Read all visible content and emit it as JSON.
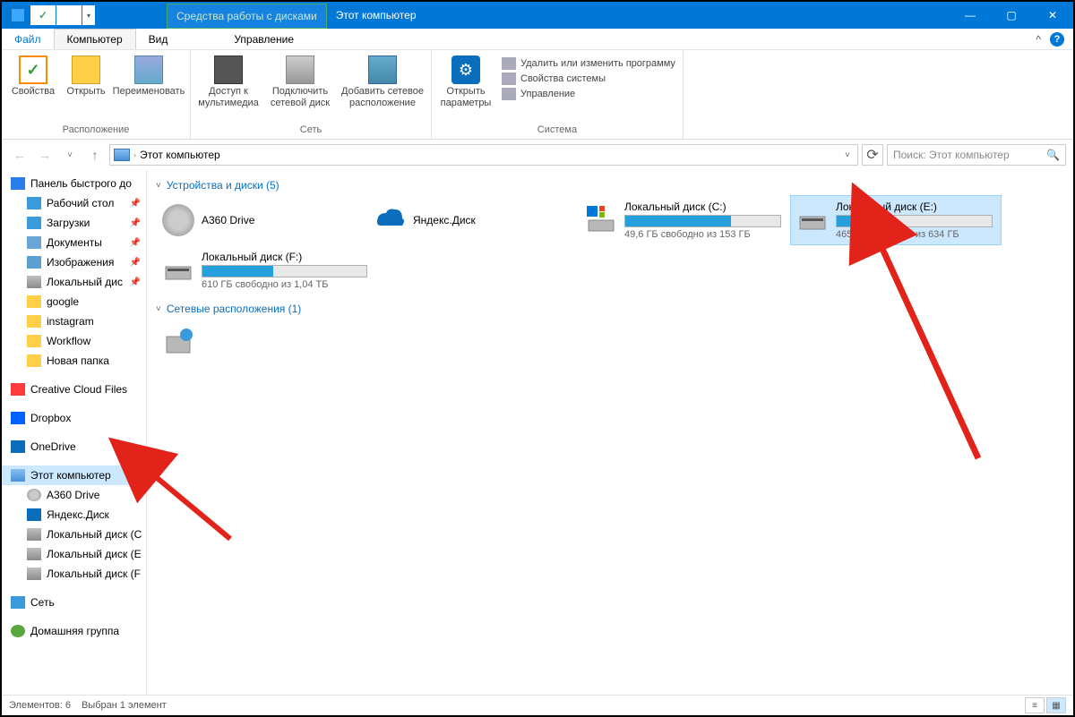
{
  "window": {
    "ctx_tab": "Средства работы с дисками",
    "title": "Этот компьютер",
    "minimize": "—",
    "maximize": "▢",
    "close": "✕"
  },
  "tabs": {
    "file": "Файл",
    "computer": "Компьютер",
    "view": "Вид",
    "manage": "Управление",
    "collapse": "^"
  },
  "ribbon": {
    "properties": "Свойства",
    "open": "Открыть",
    "rename": "Переименовать",
    "group_location": "Расположение",
    "media_access": "Доступ к\nмультимедиа",
    "map_drive": "Подключить\nсетевой диск",
    "add_net": "Добавить сетевое\nрасположение",
    "group_network": "Сеть",
    "open_settings": "Открыть\nпараметры",
    "uninstall": "Удалить или изменить программу",
    "sys_props": "Свойства системы",
    "manage": "Управление",
    "group_system": "Система"
  },
  "addr": {
    "path": "Этот компьютер",
    "refresh": "⟳"
  },
  "search": {
    "placeholder": "Поиск: Этот компьютер"
  },
  "sidebar": {
    "quick": "Панель быстрого до",
    "items1": [
      {
        "lb": "Рабочий стол",
        "ic": "ic-desk",
        "pin": true
      },
      {
        "lb": "Загрузки",
        "ic": "ic-dl",
        "pin": true
      },
      {
        "lb": "Документы",
        "ic": "ic-doc",
        "pin": true
      },
      {
        "lb": "Изображения",
        "ic": "ic-img",
        "pin": true
      },
      {
        "lb": "Локальный дис",
        "ic": "ic-drive",
        "pin": true
      },
      {
        "lb": "google",
        "ic": "ic-folder",
        "pin": false
      },
      {
        "lb": "instagram",
        "ic": "ic-folder",
        "pin": false
      },
      {
        "lb": "Workflow",
        "ic": "ic-folder",
        "pin": false
      },
      {
        "lb": "Новая папка",
        "ic": "ic-folder",
        "pin": false
      }
    ],
    "cc": "Creative Cloud Files",
    "dropbox": "Dropbox",
    "onedrive": "OneDrive",
    "thispc": "Этот компьютер",
    "items2": [
      {
        "lb": "A360 Drive",
        "ic": "ic-a360"
      },
      {
        "lb": "Яндекс.Диск",
        "ic": "ic-yd"
      },
      {
        "lb": "Локальный диск (С",
        "ic": "ic-drive"
      },
      {
        "lb": "Локальный диск (E",
        "ic": "ic-drive"
      },
      {
        "lb": "Локальный диск (F",
        "ic": "ic-drive"
      }
    ],
    "network": "Сеть",
    "homegroup": "Домашняя группа"
  },
  "content": {
    "sec_devices": "Устройства и диски (5)",
    "sec_network": "Сетевые расположения (1)",
    "a360": "A360 Drive",
    "yadisk": "Яндекс.Диск",
    "c": {
      "name": "Локальный диск (C:)",
      "stat": "49,6 ГБ свободно из 153 ГБ",
      "fill": 68
    },
    "e": {
      "name": "Локальный диск (E:)",
      "stat": "465 ГБ свободно из 634 ГБ",
      "fill": 27
    },
    "f": {
      "name": "Локальный диск (F:)",
      "stat": "610 ГБ свободно из 1,04 ТБ",
      "fill": 43
    }
  },
  "status": {
    "count": "Элементов: 6",
    "sel": "Выбран 1 элемент"
  }
}
